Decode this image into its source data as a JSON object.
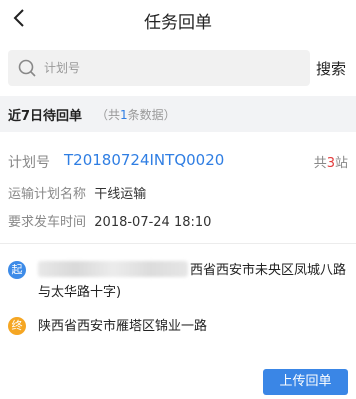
{
  "header": {
    "title": "任务回单"
  },
  "search": {
    "placeholder": "计划号",
    "value": "",
    "button_label": "搜索"
  },
  "section": {
    "title": "近7日待回单",
    "count_prefix": "（共",
    "count": "1",
    "count_suffix": "条数据）"
  },
  "task": {
    "plan_label": "计划号",
    "plan_number": "T20180724INTQ0020",
    "stops_prefix": "共",
    "stops_count": "3",
    "stops_suffix": "站",
    "plan_name_label": "运输计划名称",
    "plan_name_value": "干线运输",
    "departure_label": "要求发车时间",
    "departure_value": "2018-07-24 18:10",
    "start_marker": "起",
    "start_address_visible": "西省西安市未央区凤城八路与太华路十字)",
    "end_marker": "终",
    "end_address": "陕西省西安市雁塔区锦业一路",
    "upload_label": "上传回单"
  },
  "colors": {
    "accent": "#2f7ee3",
    "start_marker": "#3d8be8",
    "end_marker": "#f5a623",
    "stops_count": "#e23c3c"
  },
  "icons": {
    "back": "back-arrow-icon",
    "search": "search-icon"
  }
}
